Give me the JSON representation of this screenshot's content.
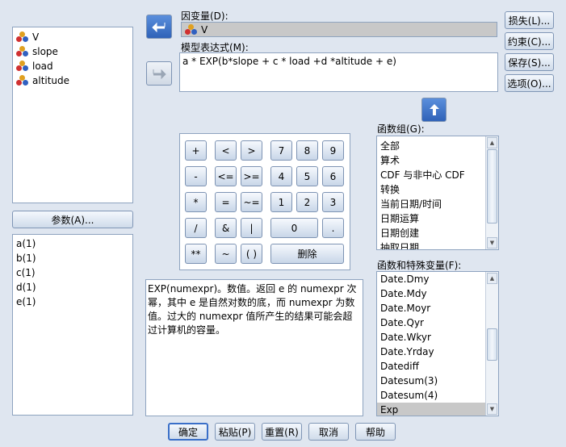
{
  "variables": [
    "V",
    "slope",
    "load",
    "altitude"
  ],
  "params_button": "参数(A)...",
  "params": [
    "a(1)",
    "b(1)",
    "c(1)",
    "d(1)",
    "e(1)"
  ],
  "dependent": {
    "label": "因变量(D):",
    "value": "V"
  },
  "model": {
    "label": "模型表达式(M):",
    "value": "a * EXP(b*slope + c * load +d *altitude + e)"
  },
  "right_buttons": [
    "损失(L)...",
    "约束(C)...",
    "保存(S)...",
    "选项(O)..."
  ],
  "keypad": [
    [
      "+",
      "<",
      ">",
      "7",
      "8",
      "9"
    ],
    [
      "-",
      "<=",
      ">=",
      "4",
      "5",
      "6"
    ],
    [
      "*",
      "=",
      "~=",
      "1",
      "2",
      "3"
    ],
    [
      "/",
      "&",
      "|",
      "0",
      "."
    ],
    [
      "**",
      "~",
      "( )",
      "删除"
    ]
  ],
  "description": "EXP(numexpr)。数值。返回 e 的 numexpr 次幂，其中 e 是自然对数的底，而 numexpr 为数值。过大的 numexpr 值所产生的结果可能会超过计算机的容量。",
  "function_group": {
    "label": "函数组(G):",
    "items": [
      "全部",
      "算术",
      "CDF 与非中心 CDF",
      "转换",
      "当前日期/时间",
      "日期运算",
      "日期创建",
      "抽取日期"
    ]
  },
  "functions": {
    "label": "函数和特殊变量(F):",
    "items": [
      "Date.Dmy",
      "Date.Mdy",
      "Date.Moyr",
      "Date.Qyr",
      "Date.Wkyr",
      "Date.Yrday",
      "Datediff",
      "Datesum(3)",
      "Datesum(4)",
      "Exp"
    ],
    "selected": "Exp"
  },
  "bottom_buttons": [
    "确定",
    "粘贴(P)",
    "重置(R)",
    "取消",
    "帮助"
  ],
  "colors": {
    "accent": "#3a6fc8",
    "selection": "#c8c8c8",
    "background": "#dfe6f0"
  }
}
